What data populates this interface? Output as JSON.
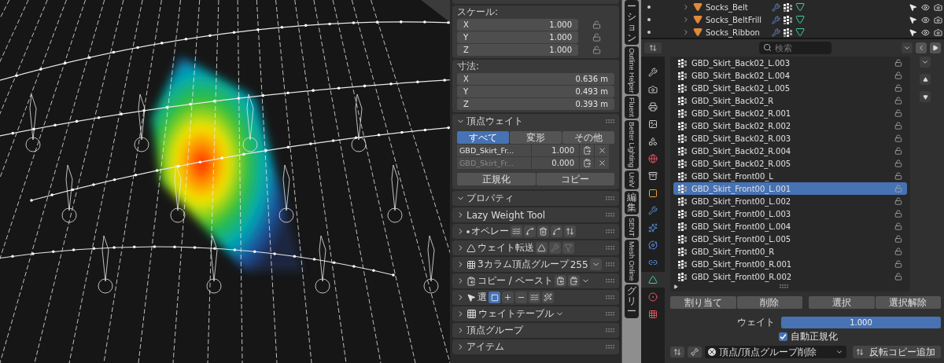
{
  "sidebar": {
    "scale": {
      "label": "スケール:",
      "fields": [
        {
          "axis": "X",
          "value": "1.000"
        },
        {
          "axis": "Y",
          "value": "1.000"
        },
        {
          "axis": "Z",
          "value": "1.000"
        }
      ]
    },
    "dimensions": {
      "label": "寸法:",
      "fields": [
        {
          "axis": "X",
          "value": "0.636 m"
        },
        {
          "axis": "Y",
          "value": "0.493 m"
        },
        {
          "axis": "Z",
          "value": "0.393 m"
        }
      ]
    },
    "vertex_weights": {
      "title": "頂点ウェイト",
      "expanded": true,
      "tabs": [
        {
          "label": "すべて",
          "selected": true
        },
        {
          "label": "変形",
          "selected": false
        },
        {
          "label": "その他",
          "selected": false
        }
      ],
      "rows": [
        {
          "group": "GBD_Skirt_Fr...",
          "value": "1.000",
          "active": true
        },
        {
          "group": "GBD_Skirt_Fr...",
          "value": "0.000",
          "active": false
        }
      ],
      "buttons": [
        "正規化",
        "コピー"
      ]
    },
    "panels": [
      {
        "title": "プロパティ",
        "expanded": true
      },
      {
        "title": "Lazy Weight Tool",
        "expanded": false
      },
      {
        "title": "オペレー",
        "expanded": false
      },
      {
        "title": "ウェイト転送",
        "expanded": false
      },
      {
        "title": "3カラム頂点グループ",
        "expanded": false,
        "count": "255"
      },
      {
        "title": "コピー / ペースト",
        "expanded": false
      },
      {
        "title": "選",
        "expanded": false
      },
      {
        "title": "ウェイトテーブル",
        "expanded": false
      },
      {
        "title": "頂点グループ",
        "expanded": false
      },
      {
        "title": "アイテム",
        "expanded": false
      }
    ]
  },
  "tab_strip": [
    {
      "label": "ーション",
      "kind": "cjk"
    },
    {
      "label": "Outline Helper",
      "kind": "latin"
    },
    {
      "label": "Fluent",
      "kind": "latin"
    },
    {
      "label": "Better Lighting",
      "kind": "latin"
    },
    {
      "label": "UniV",
      "kind": "latin"
    },
    {
      "label": "編集",
      "kind": "cjk"
    },
    {
      "label": "SENT",
      "kind": "latin"
    },
    {
      "label": "Mesh Online",
      "kind": "latin"
    },
    {
      "label": "グリー",
      "kind": "cjk"
    }
  ],
  "outliner": {
    "rows": [
      {
        "name": "Socks_Belt"
      },
      {
        "name": "Socks_BeltFrill"
      },
      {
        "name": "Socks_Ribbon"
      }
    ]
  },
  "properties": {
    "search": {
      "placeholder": "検索"
    },
    "tabs": [
      {
        "selected": false
      },
      {
        "selected": false
      },
      {
        "selected": false
      },
      {
        "selected": false
      },
      {
        "selected": false
      },
      {
        "selected": false
      },
      {
        "selected": false
      },
      {
        "selected": false
      },
      {
        "selected": false
      },
      {
        "selected": false
      },
      {
        "selected": false
      },
      {
        "selected": false
      },
      {
        "selected": true
      },
      {
        "selected": false
      },
      {
        "selected": false
      }
    ],
    "vertex_groups": [
      {
        "name": "GBD_Skirt_Back02_L.003",
        "selected": false
      },
      {
        "name": "GBD_Skirt_Back02_L.004",
        "selected": false
      },
      {
        "name": "GBD_Skirt_Back02_L.005",
        "selected": false
      },
      {
        "name": "GBD_Skirt_Back02_R",
        "selected": false
      },
      {
        "name": "GBD_Skirt_Back02_R.001",
        "selected": false
      },
      {
        "name": "GBD_Skirt_Back02_R.002",
        "selected": false
      },
      {
        "name": "GBD_Skirt_Back02_R.003",
        "selected": false
      },
      {
        "name": "GBD_Skirt_Back02_R.004",
        "selected": false
      },
      {
        "name": "GBD_Skirt_Back02_R.005",
        "selected": false
      },
      {
        "name": "GBD_Skirt_Front00_L",
        "selected": false
      },
      {
        "name": "GBD_Skirt_Front00_L.001",
        "selected": true
      },
      {
        "name": "GBD_Skirt_Front00_L.002",
        "selected": false
      },
      {
        "name": "GBD_Skirt_Front00_L.003",
        "selected": false
      },
      {
        "name": "GBD_Skirt_Front00_L.004",
        "selected": false
      },
      {
        "name": "GBD_Skirt_Front00_L.005",
        "selected": false
      },
      {
        "name": "GBD_Skirt_Front00_R",
        "selected": false
      },
      {
        "name": "GBD_Skirt_Front00_R.001",
        "selected": false
      },
      {
        "name": "GBD_Skirt_Front00_R.002",
        "selected": false
      }
    ],
    "buttons": [
      "割り当て",
      "削除",
      "選択",
      "選択解除"
    ],
    "weight": {
      "label": "ウェイト",
      "value": "1.000",
      "level": 1
    },
    "auto_normalize": {
      "label": "自動正規化",
      "checked": true
    },
    "delete_menu": {
      "value": "頂点/頂点グループ削除"
    },
    "mirror_button": "反転コピー追加"
  }
}
